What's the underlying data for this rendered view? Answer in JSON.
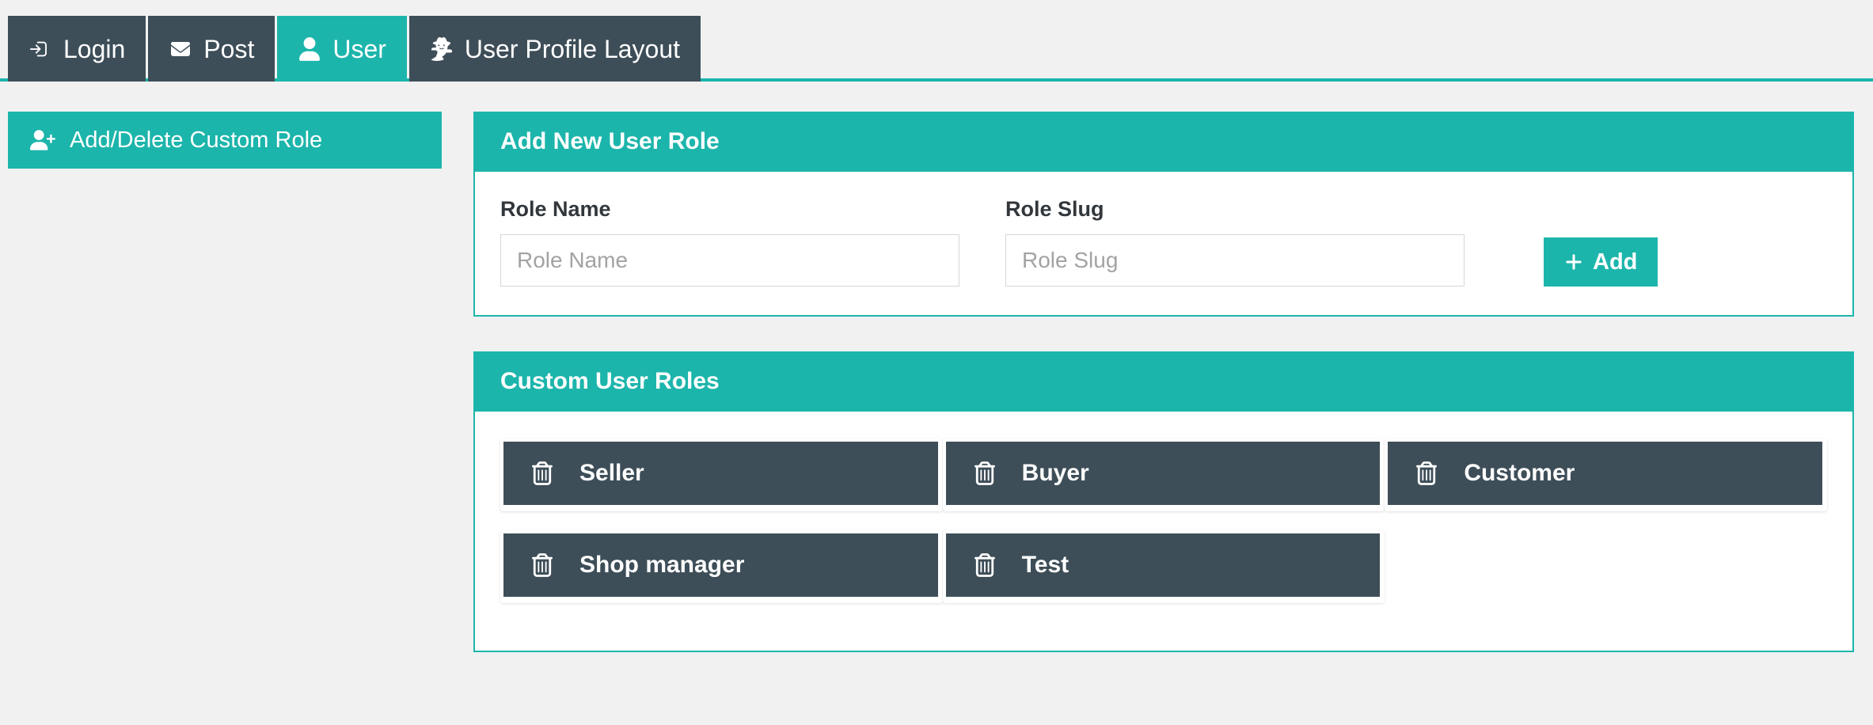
{
  "theme": {
    "accent": "#1cb5ab",
    "dark": "#3e4e58",
    "page_bg": "#f1f1f1",
    "panel_bg": "#ffffff",
    "input_border": "#d6d6d6",
    "placeholder": "#a3a3a3"
  },
  "tabs": [
    {
      "label": "Login",
      "icon": "sign-in-icon",
      "active": false
    },
    {
      "label": "Post",
      "icon": "envelope-icon",
      "active": false
    },
    {
      "label": "User",
      "icon": "user-icon",
      "active": true
    },
    {
      "label": "User Profile Layout",
      "icon": "user-secret-icon",
      "active": false
    }
  ],
  "sidebar": {
    "items": [
      {
        "label": "Add/Delete Custom Role",
        "icon": "user-plus-icon",
        "active": true
      }
    ]
  },
  "add_role_panel": {
    "title": "Add New User Role",
    "role_name": {
      "label": "Role Name",
      "placeholder": "Role Name",
      "value": ""
    },
    "role_slug": {
      "label": "Role Slug",
      "placeholder": "Role Slug",
      "value": ""
    },
    "add_button": {
      "label": "Add",
      "icon": "plus-icon"
    }
  },
  "custom_roles_panel": {
    "title": "Custom User Roles",
    "delete_icon": "trash-icon",
    "roles": [
      {
        "label": "Seller"
      },
      {
        "label": "Buyer"
      },
      {
        "label": "Customer"
      },
      {
        "label": "Shop manager"
      },
      {
        "label": "Test"
      }
    ]
  }
}
